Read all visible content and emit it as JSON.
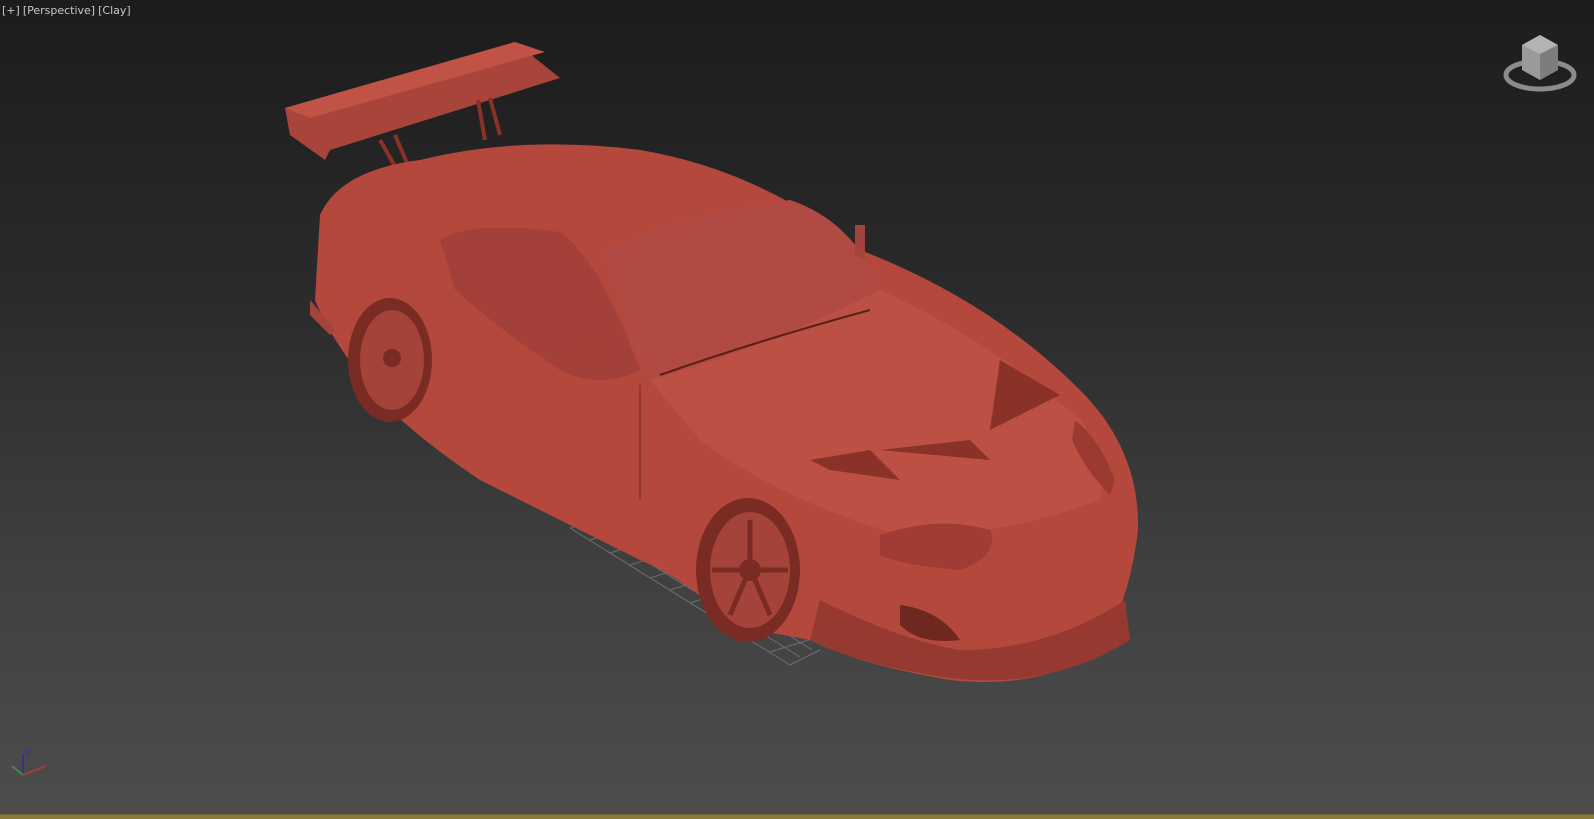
{
  "viewport": {
    "menu_label": "[+]",
    "view_label": "[Perspective]",
    "shading_label": "[Clay]"
  },
  "axis_gizmo": {
    "z_label": "Z"
  },
  "colors": {
    "clay": "#b5483d",
    "clay_dark": "#8a3128",
    "clay_light": "#c8574a",
    "grid": "#8a8a8a"
  }
}
